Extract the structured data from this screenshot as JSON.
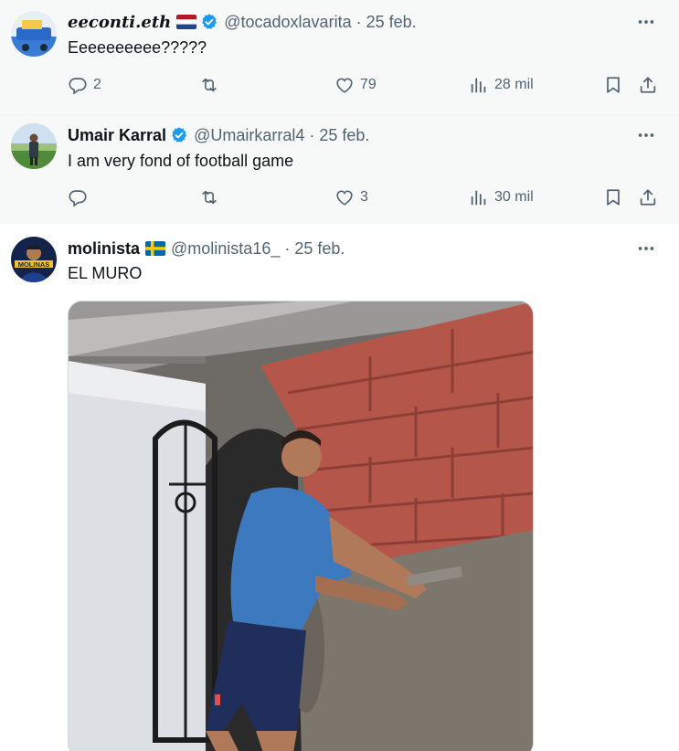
{
  "tweets": [
    {
      "name": "eeconti.eth",
      "handle": "@tocadoxlavarita",
      "separator": "·",
      "date": "25 feb.",
      "text": "Eeeeeeeeee?????",
      "reply_count": "2",
      "retweet_count": "",
      "like_count": "79",
      "view_count": "28 mil",
      "flag": "netherlands",
      "verified": true
    },
    {
      "name": "Umair Karral",
      "handle": "@Umairkarral4",
      "separator": "·",
      "date": "25 feb.",
      "text": "I am very fond of football game",
      "reply_count": "",
      "retweet_count": "",
      "like_count": "3",
      "view_count": "30 mil",
      "verified": true
    },
    {
      "name": "molinista",
      "handle": "@molinista16_",
      "separator": "·",
      "date": "25 feb.",
      "text": "EL MURO",
      "flag": "sweden",
      "avatar_text": "MOLINAS"
    }
  ],
  "colors": {
    "verified_blue": "#1d9bf0",
    "secondary_text": "#536471",
    "primary_text": "#0f1419"
  },
  "icons": [
    "reply-icon",
    "retweet-icon",
    "like-icon",
    "views-icon",
    "bookmark-icon",
    "share-icon",
    "more-icon",
    "verified-badge-icon"
  ]
}
